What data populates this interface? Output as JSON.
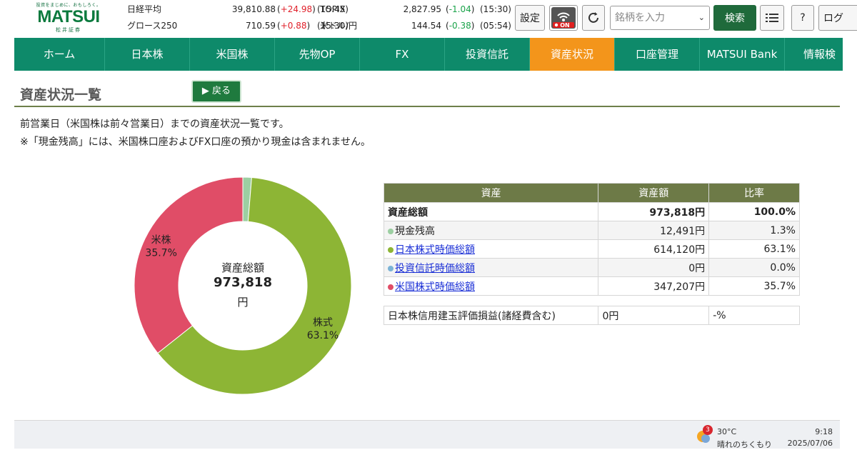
{
  "header": {
    "tagline": "投資をまじめに、おもしろく。",
    "brand": "MATSUI",
    "brand_sub": "松井証券",
    "quotes": [
      {
        "name": "日経平均",
        "value": "39,810.88",
        "change": "+24.98",
        "time": "(15:45)",
        "dir": "up"
      },
      {
        "name": "グロース250",
        "value": "710.59",
        "change": "+0.88",
        "time": "(15:30)",
        "dir": "up"
      },
      {
        "name": "TOPIX",
        "value": "2,827.95",
        "change": "-1.04",
        "time": "(15:30)",
        "dir": "down"
      },
      {
        "name": "米ドル/円",
        "value": "144.54",
        "change": "-0.38",
        "time": "(05:54)",
        "dir": "down"
      }
    ],
    "settings_label": "設定",
    "on_label": "ON",
    "search_placeholder": "銘柄を入力",
    "search_button": "検索",
    "help_label": "?",
    "login_label": "ログ"
  },
  "nav": {
    "items": [
      {
        "label": "ホーム"
      },
      {
        "label": "日本株"
      },
      {
        "label": "米国株"
      },
      {
        "label": "先物OP"
      },
      {
        "label": "FX"
      },
      {
        "label": "投資信託"
      },
      {
        "label": "資産状況",
        "active": true
      },
      {
        "label": "口座管理"
      },
      {
        "label": "MATSUI Bank"
      },
      {
        "label": "情報検"
      }
    ]
  },
  "page": {
    "title": "資産状況一覧",
    "back_label": "▶ 戻る",
    "desc1": "前営業日（米国株は前々営業日）までの資産状況一覧です。",
    "desc2": "※「現金残高」には、米国株口座およびFX口座の預かり現金は含まれません。"
  },
  "chart_data": {
    "type": "pie",
    "center_title": "資産総額",
    "center_value": "973,818",
    "center_unit": "円",
    "slices": [
      {
        "name": "現金残高",
        "value": 1.3,
        "color": "#9ccfa2"
      },
      {
        "name": "株式",
        "value": 63.1,
        "color": "#8db535",
        "label": "株式",
        "pct": "63.1%"
      },
      {
        "name": "投資信託",
        "value": 0.0,
        "color": "#7bb3d6"
      },
      {
        "name": "米株",
        "value": 35.7,
        "color": "#e04d67",
        "label": "米株",
        "pct": "35.7%"
      }
    ]
  },
  "table": {
    "headers": [
      "資産",
      "資産額",
      "比率"
    ],
    "total": {
      "label": "資産総額",
      "amount": "973,818円",
      "ratio": "100.0%"
    },
    "rows": [
      {
        "label": "現金残高",
        "amount": "12,491円",
        "ratio": "1.3%",
        "color": "#9ccfa2",
        "link": false
      },
      {
        "label": "日本株式時価総額",
        "amount": "614,120円",
        "ratio": "63.1%",
        "color": "#8db535",
        "link": true
      },
      {
        "label": "投資信託時価総額",
        "amount": "0円",
        "ratio": "0.0%",
        "color": "#7bb3d6",
        "link": true
      },
      {
        "label": "米国株式時価総額",
        "amount": "347,207円",
        "ratio": "35.7%",
        "color": "#e04d67",
        "link": true
      }
    ],
    "margin": {
      "label": "日本株信用建玉評価損益(諸経費含む)",
      "amount": "0円",
      "ratio": "-%"
    }
  },
  "taskbar": {
    "badge": "3",
    "temp": "30°C",
    "weather": "晴れのちくもり",
    "time": "9:18",
    "date": "2025/07/06"
  }
}
